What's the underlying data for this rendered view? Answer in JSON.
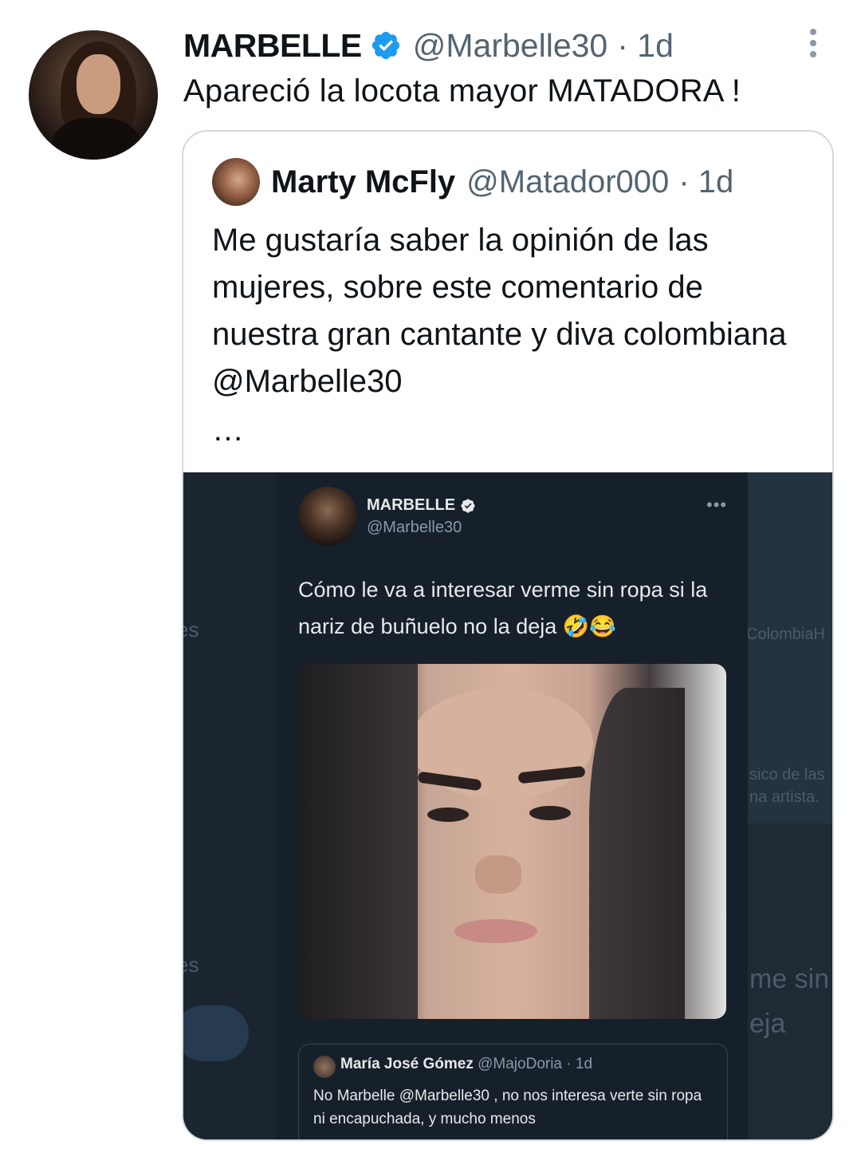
{
  "tweet": {
    "name": "MARBELLE",
    "handle": "@Marbelle30",
    "time": "· 1d",
    "text": "Apareció la locota mayor MATADORA !"
  },
  "quoted": {
    "name": "Marty McFly",
    "handle": "@Matador000",
    "time": "· 1d",
    "text": "Me gustaría saber la opinión de las mujeres, sobre este comentario de nuestra gran cantante y diva colombiana @Marbelle30",
    "ellipsis": "…"
  },
  "screenshot": {
    "name": "MARBELLE",
    "handle": "@Marbelle30",
    "more": "•••",
    "text": "Cómo le va a interesar verme sin ropa si la nariz de buñuelo no la deja 🤣😂",
    "inner_quote": {
      "name": "María José Gómez",
      "handle": "@MajoDoria",
      "time": "· 1d",
      "text": "No Marbelle @Marbelle30 , no nos interesa verte sin ropa ni encapuchada, y mucho menos"
    },
    "ghost_text": {
      "left_1": "es",
      "left_2": "es",
      "right_1": "ColombiaH",
      "right_2": "sico de las",
      "right_3": "na artista.",
      "right_4": "me sin",
      "right_5": "eja"
    }
  },
  "icons": {
    "verified": "verified-badge-icon",
    "more": "more-options-icon"
  },
  "colors": {
    "accent": "#1d9bf0",
    "secondary_text": "#536471",
    "dark_bg": "#15202b"
  }
}
